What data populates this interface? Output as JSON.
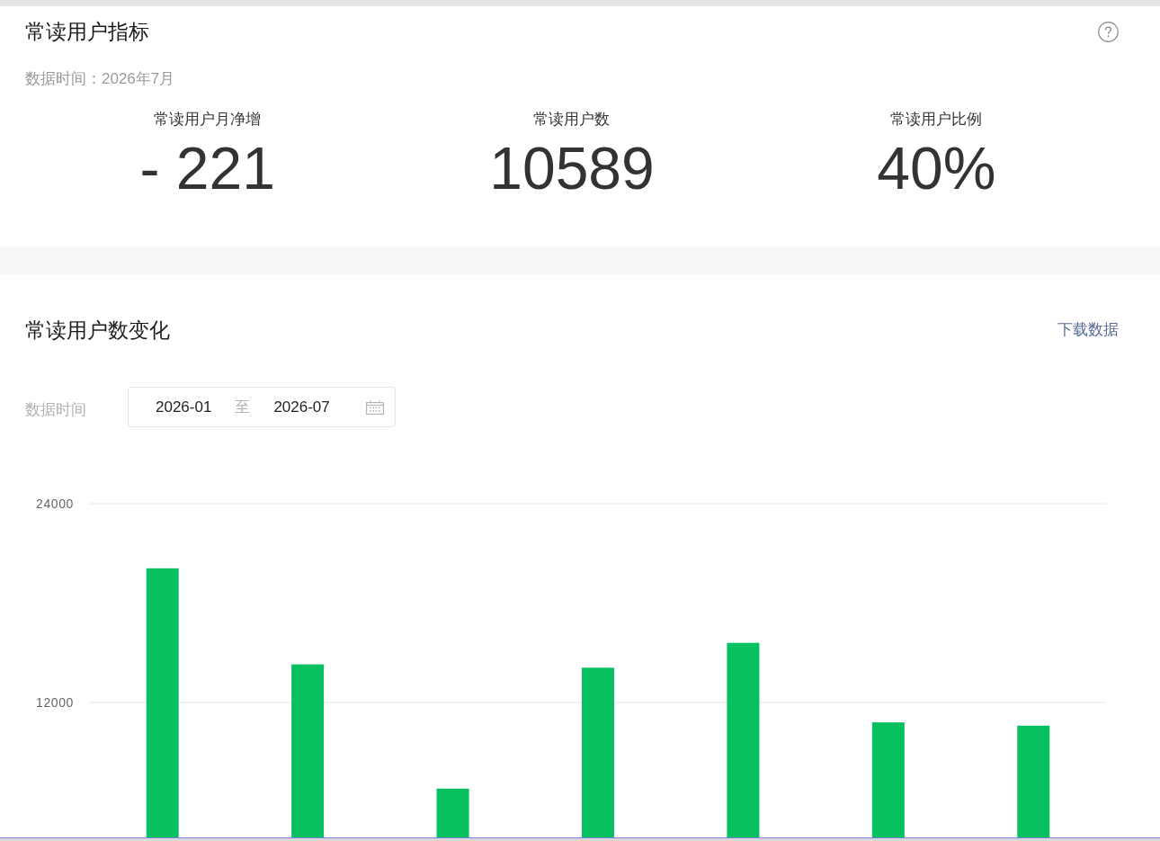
{
  "indicator_card": {
    "title": "常读用户指标",
    "data_time": "数据时间：2026年7月",
    "metrics": [
      {
        "label": "常读用户月净增",
        "value": "- 221"
      },
      {
        "label": "常读用户数",
        "value": "10589"
      },
      {
        "label": "常读用户比例",
        "value": "40%"
      }
    ]
  },
  "trend_card": {
    "title": "常读用户数变化",
    "download_link": "下载数据",
    "date_filter": {
      "label": "数据时间",
      "start": "2026-01",
      "separator": "至",
      "end": "2026-07"
    },
    "chart_data": {
      "type": "bar",
      "ylim": [
        0,
        24000
      ],
      "yticks": [
        12000,
        24000
      ],
      "values": [
        20100,
        14300,
        6800,
        14100,
        15600,
        10800,
        10600
      ]
    }
  }
}
